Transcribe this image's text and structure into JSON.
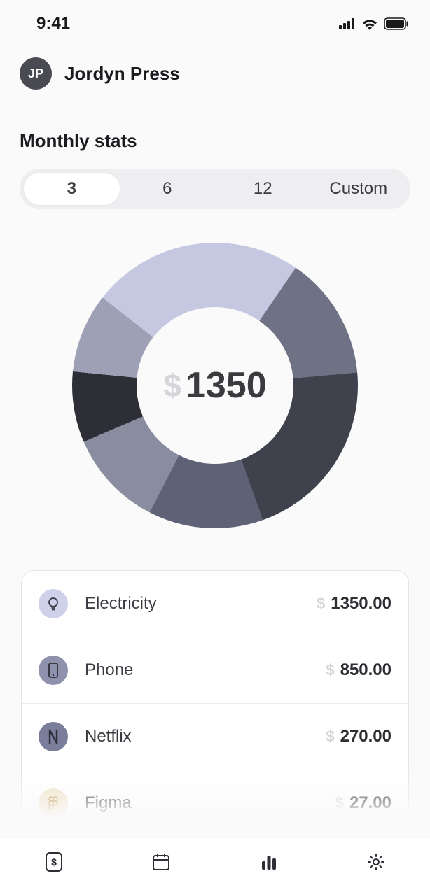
{
  "status": {
    "time": "9:41"
  },
  "profile": {
    "initials": "JP",
    "name": "Jordyn Press"
  },
  "section_title": "Monthly stats",
  "tabs": {
    "items": [
      "3",
      "6",
      "12",
      "Custom"
    ],
    "active_index": 0
  },
  "chart_data": {
    "type": "pie",
    "title": "",
    "total_label": "1350",
    "currency": "$",
    "series": [
      {
        "name": "slice-1",
        "value": 24,
        "color": "#c6c8e2"
      },
      {
        "name": "slice-2",
        "value": 14,
        "color": "#6f7285"
      },
      {
        "name": "slice-3",
        "value": 21,
        "color": "#3f414d"
      },
      {
        "name": "slice-4",
        "value": 13,
        "color": "#5f6276"
      },
      {
        "name": "slice-5",
        "value": 11,
        "color": "#8a8da0"
      },
      {
        "name": "slice-6",
        "value": 8,
        "color": "#2e2f36"
      },
      {
        "name": "slice-7",
        "value": 9,
        "color": "#9ea1b6"
      }
    ]
  },
  "expenses": [
    {
      "icon": "bulb",
      "icon_bg": "#cfd1ea",
      "icon_fg": "#3c3d48",
      "name": "Electricity",
      "currency": "$",
      "amount": "1350.00"
    },
    {
      "icon": "phone",
      "icon_bg": "#8f92ad",
      "icon_fg": "#2e2f38",
      "name": "Phone",
      "currency": "$",
      "amount": "850.00"
    },
    {
      "icon": "netflix",
      "icon_bg": "#7b7e9a",
      "icon_fg": "#2e2f38",
      "name": "Netflix",
      "currency": "$",
      "amount": "270.00"
    },
    {
      "icon": "figma",
      "icon_bg": "#f1e3c6",
      "icon_fg": "#b58a3c",
      "name": "Figma",
      "currency": "$",
      "amount": "27.00"
    }
  ],
  "nav": {
    "items": [
      "money",
      "calendar",
      "stats",
      "settings"
    ],
    "active_index": 2
  }
}
